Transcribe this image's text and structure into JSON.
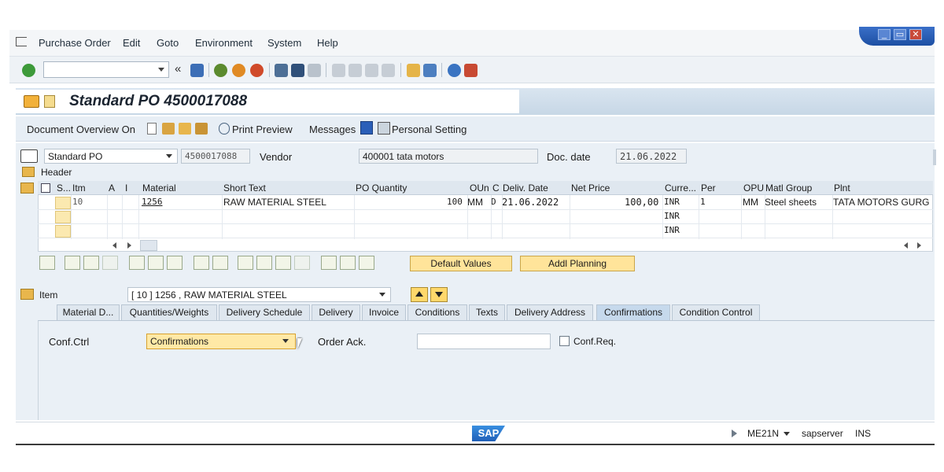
{
  "menu": {
    "items": [
      "Purchase Order",
      "Edit",
      "Goto",
      "Environment",
      "System",
      "Help"
    ]
  },
  "window_controls": {
    "minimize": "_",
    "restore": "▭",
    "close": "✕"
  },
  "toolbar": {
    "command_value": "",
    "back_chevron": "«"
  },
  "header": {
    "title": "Standard PO 4500017088"
  },
  "app_toolbar": {
    "document_overview": "Document Overview On",
    "print_preview": "Print Preview",
    "messages": "Messages",
    "personal_setting": "Personal Setting"
  },
  "po_header": {
    "po_type": "Standard PO",
    "po_number": "4500017088",
    "vendor_label": "Vendor",
    "vendor_value": "400001 tata motors",
    "doc_date_label": "Doc. date",
    "doc_date_value": "21.06.2022",
    "header_label": "Header"
  },
  "items_grid": {
    "columns": [
      "S...",
      "Itm",
      "A",
      "I",
      "Material",
      "Short Text",
      "PO Quantity",
      "OUn",
      "C",
      "Deliv. Date",
      "Net Price",
      "Curre...",
      "Per",
      "OPU",
      "Matl Group",
      "Plnt"
    ],
    "rows": [
      {
        "itm": "10",
        "material": "1256",
        "short_text": "RAW MATERIAL STEEL",
        "po_qty": "100",
        "oun": "MM",
        "c": "D",
        "deliv_date": "21.06.2022",
        "net_price": "100,00",
        "currency": "INR",
        "per": "1",
        "opu": "MM",
        "matl_group": "Steel sheets",
        "plnt": "TATA MOTORS GURG"
      },
      {
        "itm": "",
        "material": "",
        "short_text": "",
        "po_qty": "",
        "oun": "",
        "c": "",
        "deliv_date": "",
        "net_price": "",
        "currency": "INR",
        "per": "",
        "opu": "",
        "matl_group": "",
        "plnt": ""
      },
      {
        "itm": "",
        "material": "",
        "short_text": "",
        "po_qty": "",
        "oun": "",
        "c": "",
        "deliv_date": "",
        "net_price": "",
        "currency": "INR",
        "per": "",
        "opu": "",
        "matl_group": "",
        "plnt": ""
      }
    ],
    "default_values_btn": "Default Values",
    "addl_planning_btn": "Addl Planning"
  },
  "item_detail": {
    "item_label": "Item",
    "item_select": "[ 10 ] 1256 , RAW MATERIAL STEEL",
    "tabs": [
      "Material D...",
      "Quantities/Weights",
      "Delivery Schedule",
      "Delivery",
      "Invoice",
      "Conditions",
      "Texts",
      "Delivery Address",
      "Confirmations",
      "Condition Control"
    ],
    "active_tab": "Confirmations",
    "conf_ctrl_label": "Conf.Ctrl",
    "conf_ctrl_value": "Confirmations",
    "order_ack_label": "Order Ack.",
    "order_ack_value": "",
    "conf_req_label": "Conf.Req.",
    "conf_req_checked": false
  },
  "status_bar": {
    "logo": "SAP",
    "transaction": "ME21N",
    "server": "sapserver",
    "mode": "INS"
  },
  "colors": {
    "accent": "#2b5fb8",
    "highlight_field": "#ffe9a6",
    "tab_active": "#c6d9ec"
  }
}
